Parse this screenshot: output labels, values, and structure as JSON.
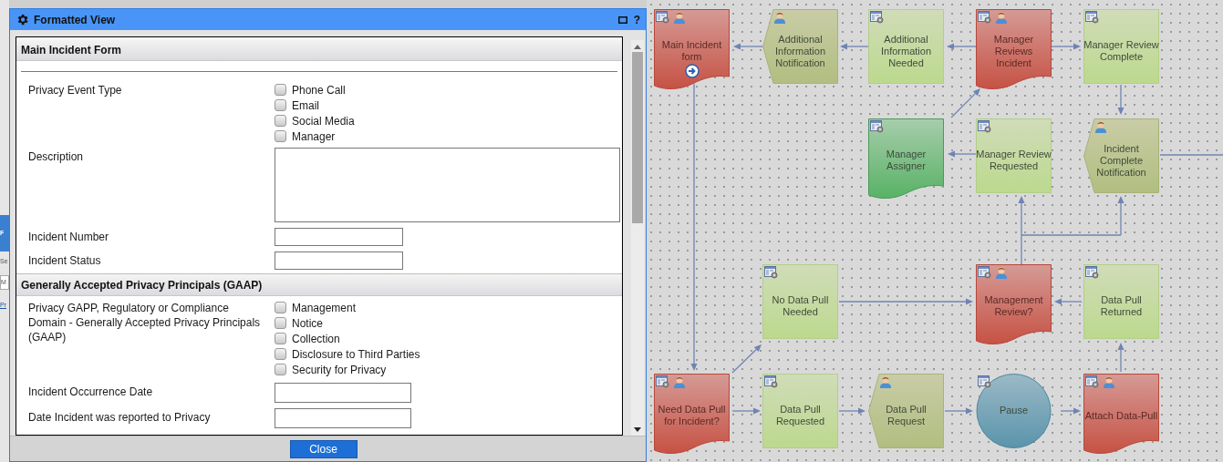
{
  "background": {
    "fragments": [
      {
        "text": "F",
        "kind": "band"
      },
      {
        "text": "Se",
        "kind": "plain"
      },
      {
        "text": "M",
        "kind": "field"
      },
      {
        "text": "Pr",
        "kind": "link"
      }
    ]
  },
  "dialog": {
    "title": "Formatted View",
    "help": "?",
    "button": "Close",
    "sections": [
      {
        "title": "Main Incident Form",
        "rule": true,
        "rows": [
          {
            "label": "Privacy Event Type",
            "kind": "checkboxes",
            "options": [
              {
                "label": "Phone Call",
                "checked": false
              },
              {
                "label": "Email",
                "checked": false
              },
              {
                "label": "Social Media",
                "checked": false
              },
              {
                "label": "Manager",
                "checked": false
              }
            ]
          },
          {
            "label": "Description",
            "kind": "textarea"
          },
          {
            "label": "Incident Number",
            "kind": "text"
          },
          {
            "label": "Incident Status",
            "kind": "text"
          }
        ]
      },
      {
        "title": "Generally Accepted Privacy Principals (GAAP)",
        "rule": false,
        "rows": [
          {
            "label": "Privacy GAPP, Regulatory or Compliance Domain - Generally Accepted Privacy Principals (GAAP)",
            "kind": "checkboxes",
            "options": [
              {
                "label": "Management",
                "checked": false
              },
              {
                "label": "Notice",
                "checked": false
              },
              {
                "label": "Collection",
                "checked": false
              },
              {
                "label": "Disclosure to Third Parties",
                "checked": false
              },
              {
                "label": "Security for Privacy",
                "checked": false
              }
            ]
          },
          {
            "label": "Incident Occurrence Date",
            "kind": "date"
          },
          {
            "label": "Date Incident was reported to Privacy",
            "kind": "date"
          }
        ]
      }
    ]
  },
  "workflow": {
    "rows": [
      [
        {
          "label": "Main Incident form",
          "kind": "task",
          "form_icon": true,
          "person_icon": true,
          "current": true
        },
        {
          "label": "Additional Information Notification",
          "kind": "notification",
          "form_icon": false,
          "person_icon": true,
          "current": false
        },
        {
          "label": "Additional Information Needed",
          "kind": "step",
          "form_icon": true,
          "person_icon": false,
          "current": false
        },
        {
          "label": "Manager Reviews Incident",
          "kind": "task",
          "form_icon": true,
          "person_icon": true,
          "current": false
        },
        {
          "label": "Manager Review Complete",
          "kind": "step",
          "form_icon": true,
          "person_icon": false,
          "current": false
        }
      ],
      [
        null,
        null,
        {
          "label": "Manager Assigner",
          "kind": "assign",
          "form_icon": true,
          "person_icon": false,
          "current": false
        },
        {
          "label": "Manager Review Requested",
          "kind": "step",
          "form_icon": true,
          "person_icon": false,
          "current": false
        },
        {
          "label": "Incident Complete Notification",
          "kind": "notification",
          "form_icon": false,
          "person_icon": true,
          "current": false
        }
      ],
      [
        null,
        {
          "label": "No Data Pull Needed",
          "kind": "step",
          "form_icon": true,
          "person_icon": false,
          "current": false
        },
        null,
        {
          "label": "Management Review?",
          "kind": "task",
          "form_icon": true,
          "person_icon": true,
          "current": false
        },
        {
          "label": "Data Pull Returned",
          "kind": "step",
          "form_icon": true,
          "person_icon": false,
          "current": false
        }
      ],
      [
        {
          "label": "Need Data Pull for Incident?",
          "kind": "task",
          "form_icon": true,
          "person_icon": true,
          "current": false
        },
        {
          "label": "Data Pull Requested",
          "kind": "step",
          "form_icon": true,
          "person_icon": false,
          "current": false
        },
        {
          "label": "Data Pull Request",
          "kind": "notification",
          "form_icon": false,
          "person_icon": true,
          "current": false
        },
        {
          "label": "Pause",
          "kind": "pause",
          "form_icon": true,
          "person_icon": false,
          "current": false
        },
        {
          "label": "Attach Data-Pull",
          "kind": "task",
          "form_icon": true,
          "person_icon": true,
          "current": false
        }
      ]
    ]
  }
}
